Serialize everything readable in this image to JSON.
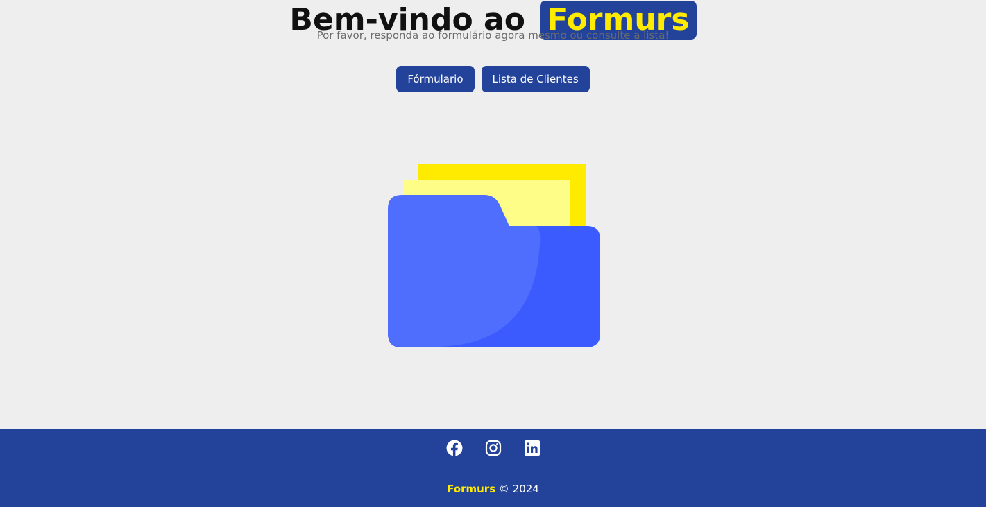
{
  "hero": {
    "title_prefix": "Bem-vindo ao",
    "brand": "Formurs",
    "subtitle": "Por favor, responda ao formulário agora mesmo ou consulte a lista!"
  },
  "actions": {
    "form_label": "Fórmulario",
    "list_label": "Lista de Clientes"
  },
  "illustration": {
    "icon": "folder-icon",
    "colors": {
      "back_paper": "#ffeb00",
      "front_paper": "#fdfd88",
      "folder_back": "#3b5bff",
      "folder_front": "#506efe"
    }
  },
  "footer": {
    "social": [
      "facebook-icon",
      "instagram-icon",
      "linkedin-icon"
    ],
    "brand": "Formurs",
    "copyright": "© 2024"
  },
  "colors": {
    "primary": "#23439b",
    "accent": "#ffeb00",
    "background": "#efeeef"
  }
}
